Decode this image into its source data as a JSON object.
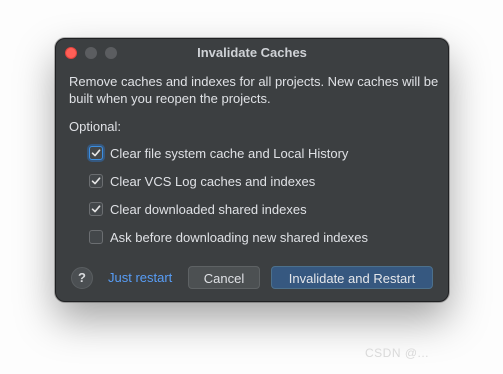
{
  "dialog": {
    "title": "Invalidate Caches",
    "message": "Remove caches and indexes for all projects. New caches will be built when you reopen the projects.",
    "optional_label": "Optional:",
    "options": [
      {
        "label": "Clear file system cache and Local History",
        "checked": true
      },
      {
        "label": "Clear VCS Log caches and indexes",
        "checked": true
      },
      {
        "label": "Clear downloaded shared indexes",
        "checked": true
      },
      {
        "label": "Ask before downloading new shared indexes",
        "checked": false
      }
    ],
    "help_label": "?",
    "just_restart_label": "Just restart",
    "cancel_label": "Cancel",
    "primary_label": "Invalidate and Restart"
  },
  "watermark": "CSDN @...",
  "colors": {
    "dialog_bg": "#3c3f41",
    "accent_link": "#589df6",
    "primary_button": "#365880",
    "close_button": "#ff5f57"
  },
  "icons": {
    "help": "question-mark-icon",
    "checkbox": "checkmark-icon"
  }
}
